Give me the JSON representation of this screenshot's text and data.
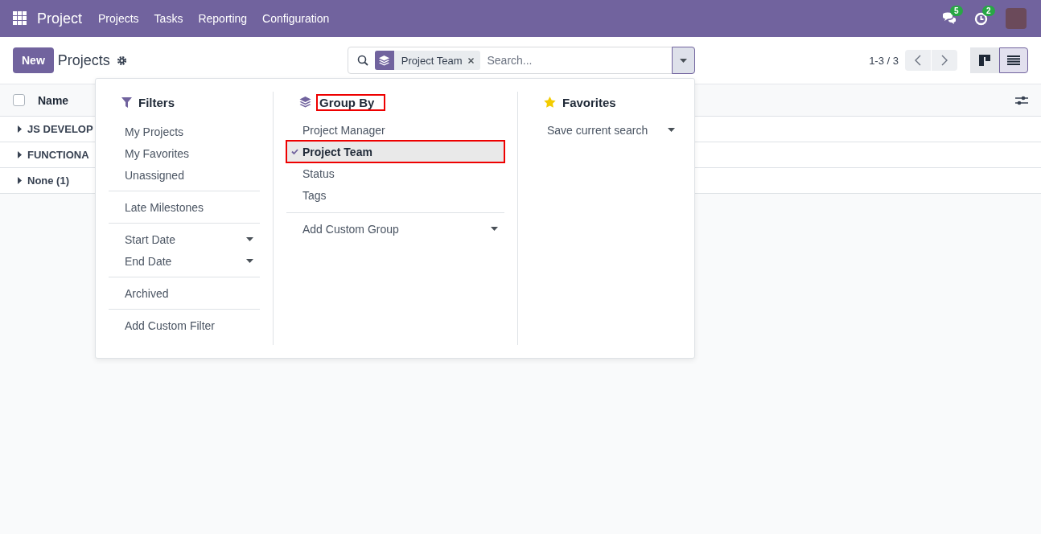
{
  "navbar": {
    "app_name": "Project",
    "menu": [
      "Projects",
      "Tasks",
      "Reporting",
      "Configuration"
    ],
    "messages_badge": "5",
    "activities_badge": "2"
  },
  "control_panel": {
    "new_button": "New",
    "title": "Projects",
    "search": {
      "facet": "Project Team",
      "placeholder": "Search..."
    },
    "pager": "1-3 / 3",
    "views": [
      {
        "kind": "kanban",
        "selected": false
      },
      {
        "kind": "list",
        "selected": true
      }
    ]
  },
  "list": {
    "checked": false,
    "column": "Name",
    "groups": [
      "JS DEVELOP",
      "FUNCTIONA",
      "None (1)"
    ]
  },
  "search_panel": {
    "filters": {
      "title": "Filters",
      "sections": [
        [
          {
            "label": "My Projects",
            "kind": "option"
          },
          {
            "label": "My Favorites",
            "kind": "option"
          },
          {
            "label": "Unassigned",
            "kind": "option"
          }
        ],
        [
          {
            "label": "Late Milestones",
            "kind": "option"
          }
        ],
        [
          {
            "label": "Start Date",
            "kind": "submenu"
          },
          {
            "label": "End Date",
            "kind": "submenu"
          }
        ],
        [
          {
            "label": "Archived",
            "kind": "option"
          }
        ],
        [
          {
            "label": "Add Custom Filter",
            "kind": "option"
          }
        ]
      ]
    },
    "group_by": {
      "title": "Group By",
      "highlighted": true,
      "items": [
        {
          "label": "Project Manager",
          "selected": false,
          "highlighted": false
        },
        {
          "label": "Project Team",
          "selected": true,
          "highlighted": true
        },
        {
          "label": "Status",
          "selected": false,
          "highlighted": false
        },
        {
          "label": "Tags",
          "selected": false,
          "highlighted": false
        }
      ],
      "custom": "Add Custom Group"
    },
    "favorites": {
      "title": "Favorites",
      "save": "Save current search"
    }
  }
}
